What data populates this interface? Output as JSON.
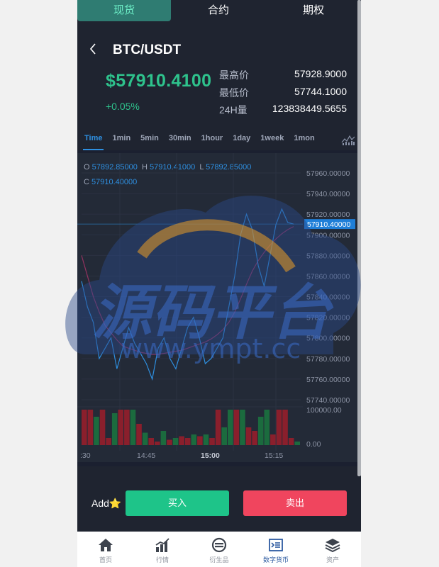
{
  "top_tabs": [
    "现货",
    "合约",
    "期权"
  ],
  "header": {
    "pair": "BTC/USDT"
  },
  "ticker": {
    "price": "$57910.4100",
    "change": "+0.05%",
    "stats": [
      {
        "label": "最高价",
        "value": "57928.9000"
      },
      {
        "label": "最低价",
        "value": "57744.1000"
      },
      {
        "label": "24H量",
        "value": "123838449.5655"
      }
    ]
  },
  "intervals": [
    "Time",
    "1min",
    "5min",
    "30min",
    "1hour",
    "1day",
    "1week",
    "1mon"
  ],
  "ohlc": {
    "o_label": "O",
    "o": "57892.85000",
    "h_label": "H",
    "h": "57910.41000",
    "l_label": "L",
    "l": "57892.85000",
    "c_label": "C",
    "c": "57910.40000"
  },
  "chart_data": {
    "type": "line",
    "price_axis_ticks": [
      "57960.00000",
      "57940.00000",
      "57920.00000",
      "57900.00000",
      "57880.00000",
      "57860.00000",
      "57840.00000",
      "57820.00000",
      "57800.00000",
      "57780.00000",
      "57760.00000",
      "57740.00000"
    ],
    "price_ylim": [
      57740,
      57960
    ],
    "current_price_label": "57910.40000",
    "current_price": 57910.4,
    "volume_axis_ticks": [
      "100000.00",
      "0.00"
    ],
    "volume_ylim": [
      0,
      100000
    ],
    "time_ticks": [
      ":30",
      "14:45",
      "15:00",
      "15:15"
    ],
    "bold_time_tick": "15:00",
    "price_series": [
      57855,
      57830,
      57815,
      57780,
      57790,
      57800,
      57770,
      57790,
      57810,
      57795,
      57785,
      57775,
      57760,
      57790,
      57800,
      57780,
      57770,
      57790,
      57810,
      57820,
      57800,
      57775,
      57780,
      57790,
      57800,
      57830,
      57860,
      57900,
      57920,
      57905,
      57870,
      57850,
      57880,
      57910,
      57925,
      57912,
      57910.4
    ],
    "ma_series": [
      57880,
      57860,
      57840,
      57825,
      57812,
      57805,
      57798,
      57792,
      57790,
      57788,
      57786,
      57785,
      57784,
      57784,
      57785,
      57786,
      57787,
      57788,
      57790,
      57792,
      57794,
      57796,
      57799,
      57803,
      57808,
      57815,
      57825,
      57838,
      57852,
      57865,
      57875,
      57883,
      57890,
      57896,
      57901,
      57905,
      57908
    ],
    "volume_bars": [
      {
        "v": 100000,
        "up": false
      },
      {
        "v": 100000,
        "up": false
      },
      {
        "v": 80000,
        "up": true
      },
      {
        "v": 100000,
        "up": false
      },
      {
        "v": 20000,
        "up": false
      },
      {
        "v": 90000,
        "up": true
      },
      {
        "v": 100000,
        "up": false
      },
      {
        "v": 100000,
        "up": false
      },
      {
        "v": 100000,
        "up": true
      },
      {
        "v": 60000,
        "up": false
      },
      {
        "v": 35000,
        "up": true
      },
      {
        "v": 20000,
        "up": false
      },
      {
        "v": 10000,
        "up": false
      },
      {
        "v": 40000,
        "up": true
      },
      {
        "v": 15000,
        "up": false
      },
      {
        "v": 20000,
        "up": true
      },
      {
        "v": 25000,
        "up": false
      },
      {
        "v": 20000,
        "up": false
      },
      {
        "v": 30000,
        "up": true
      },
      {
        "v": 25000,
        "up": false
      },
      {
        "v": 30000,
        "up": true
      },
      {
        "v": 20000,
        "up": false
      },
      {
        "v": 100000,
        "up": false
      },
      {
        "v": 50000,
        "up": true
      },
      {
        "v": 100000,
        "up": true
      },
      {
        "v": 100000,
        "up": false
      },
      {
        "v": 100000,
        "up": true
      },
      {
        "v": 50000,
        "up": false
      },
      {
        "v": 40000,
        "up": false
      },
      {
        "v": 80000,
        "up": true
      },
      {
        "v": 100000,
        "up": true
      },
      {
        "v": 30000,
        "up": false
      },
      {
        "v": 100000,
        "up": false
      },
      {
        "v": 100000,
        "up": false
      },
      {
        "v": 20000,
        "up": false
      },
      {
        "v": 10000,
        "up": true
      }
    ]
  },
  "actions": {
    "add_label": "Add",
    "star": "⭐",
    "buy": "买入",
    "sell": "卖出"
  },
  "bottom_nav": [
    {
      "label": "首页",
      "icon": "home-icon"
    },
    {
      "label": "行情",
      "icon": "market-chart-icon"
    },
    {
      "label": "衍生品",
      "icon": "derivatives-icon"
    },
    {
      "label": "数字货币",
      "icon": "digital-currency-icon"
    },
    {
      "label": "资产",
      "icon": "assets-layers-icon"
    }
  ],
  "watermark": {
    "text_cn": "源码平台",
    "text_url": "www.ympt.cc"
  },
  "colors": {
    "background": "#1f2430",
    "up_green": "#2ec28c",
    "down_red": "#f0455e",
    "accent_blue": "#2e8fe0",
    "active_tab": "#2f7c72"
  }
}
